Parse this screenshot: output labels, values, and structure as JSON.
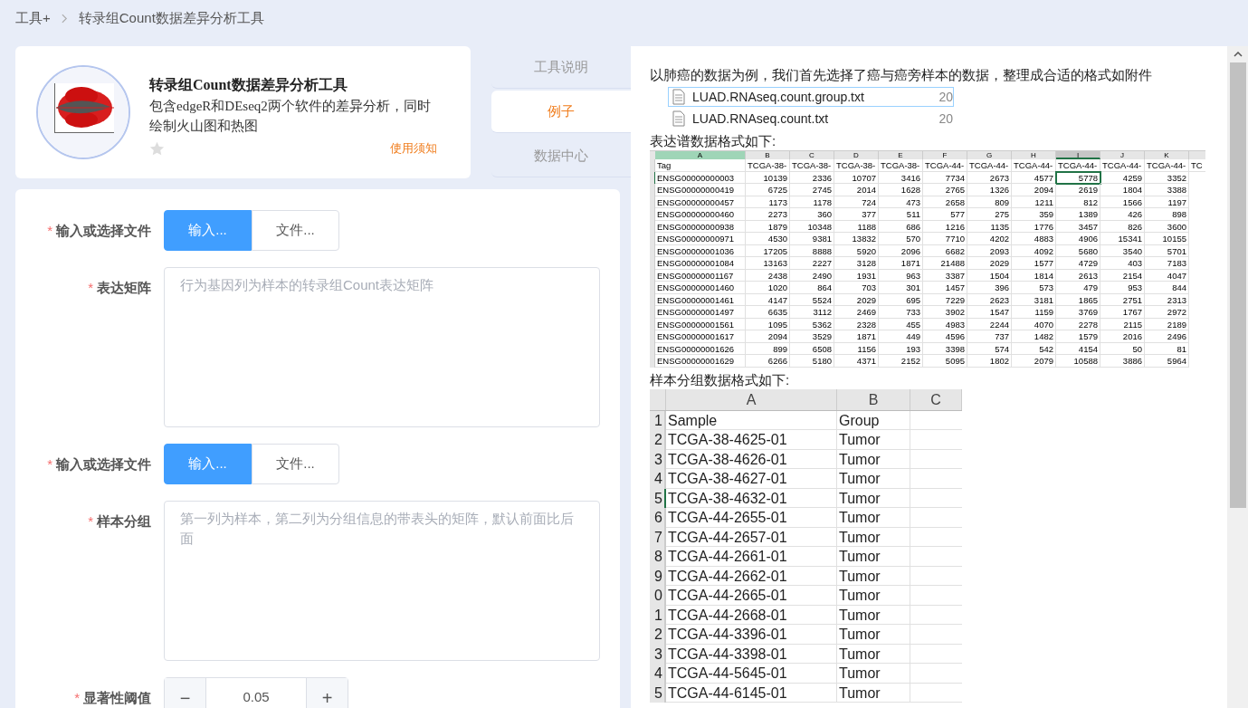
{
  "breadcrumb": [
    {
      "label": "工具+"
    },
    {
      "label": "转录组Count数据差异分析工具"
    }
  ],
  "tool_card": {
    "title": "转录组Count数据差异分析工具",
    "description": "包含edgeR和DEseq2两个软件的差异分析，同时绘制火山图和热图",
    "favorited": false,
    "link": "使用须知"
  },
  "tabs": [
    {
      "label": "工具说明",
      "selected": false
    },
    {
      "label": "例子",
      "selected": true
    },
    {
      "label": "数据中心",
      "selected": false
    }
  ],
  "form": [
    {
      "kind": "toggle",
      "label": "输入或选择文件",
      "required_mark": "*",
      "options": [
        {
          "label": "输入...",
          "selected": true
        },
        {
          "label": "文件...",
          "selected": false
        }
      ]
    },
    {
      "kind": "textarea",
      "label": "表达矩阵",
      "required_mark": "*",
      "placeholder": "行为基因列为样本的转录组Count表达矩阵"
    },
    {
      "kind": "toggle",
      "label": "输入或选择文件",
      "required_mark": "*",
      "options": [
        {
          "label": "输入...",
          "selected": true
        },
        {
          "label": "文件...",
          "selected": false
        }
      ]
    },
    {
      "kind": "textarea",
      "label": "样本分组",
      "required_mark": "*",
      "placeholder": "第一列为样本，第二列为分组信息的带表头的矩阵，默认前面比后面"
    },
    {
      "kind": "stepper",
      "label": "显著性阈值",
      "required_mark": "*",
      "minus": "−",
      "value": "0.05",
      "plus": "+"
    }
  ],
  "example": {
    "intro": "以肺癌的数据为例，我们首先选择了癌与癌旁样本的数据，整理成合适的格式如附件",
    "files": [
      {
        "name": "LUAD.RNAseq.count.group.txt",
        "date": "20",
        "selected": true
      },
      {
        "name": "LUAD.RNAseq.count.txt",
        "date": "20",
        "selected": false
      }
    ],
    "matrix_caption": "表达谱数据格式如下:",
    "matrix_sheet": {
      "columns": [
        {
          "label": "A",
          "selected": false,
          "highlight": true
        },
        {
          "label": "B",
          "selected": false,
          "highlight": false
        },
        {
          "label": "C",
          "selected": false,
          "highlight": false
        },
        {
          "label": "D",
          "selected": false,
          "highlight": false
        },
        {
          "label": "E",
          "selected": false,
          "highlight": false
        },
        {
          "label": "F",
          "selected": false,
          "highlight": false
        },
        {
          "label": "G",
          "selected": false,
          "highlight": false
        },
        {
          "label": "H",
          "selected": false,
          "highlight": false
        },
        {
          "label": "I",
          "selected": true,
          "highlight": false
        },
        {
          "label": "J",
          "selected": false,
          "highlight": false
        },
        {
          "label": "K",
          "selected": false,
          "highlight": false
        }
      ],
      "rows": [
        {
          "selected": false,
          "cells": [
            "Tag",
            "TCGA-38-",
            "TCGA-38-",
            "TCGA-38-",
            "TCGA-38-",
            "TCGA-44-",
            "TCGA-44-",
            "TCGA-44-",
            "TCGA-44-",
            "TCGA-44-",
            "TCGA-44-",
            "TC"
          ]
        },
        {
          "selected": true,
          "cells": [
            "ENSG00000000003",
            "10139",
            "2336",
            "10707",
            "3416",
            "7734",
            "2673",
            "4577",
            "5778",
            "4259",
            "3352"
          ]
        },
        {
          "selected": false,
          "cells": [
            "ENSG00000000419",
            "6725",
            "2745",
            "2014",
            "1628",
            "2765",
            "1326",
            "2094",
            "2619",
            "1804",
            "3388"
          ]
        },
        {
          "selected": false,
          "cells": [
            "ENSG00000000457",
            "1173",
            "1178",
            "724",
            "473",
            "2658",
            "809",
            "1211",
            "812",
            "1566",
            "1197"
          ]
        },
        {
          "selected": false,
          "cells": [
            "ENSG00000000460",
            "2273",
            "360",
            "377",
            "511",
            "577",
            "275",
            "359",
            "1389",
            "426",
            "898"
          ]
        },
        {
          "selected": false,
          "cells": [
            "ENSG00000000938",
            "1879",
            "10348",
            "1188",
            "686",
            "1216",
            "1135",
            "1776",
            "3457",
            "826",
            "3600"
          ]
        },
        {
          "selected": false,
          "cells": [
            "ENSG00000000971",
            "4530",
            "9381",
            "13832",
            "570",
            "7710",
            "4202",
            "4883",
            "4906",
            "15341",
            "10155"
          ]
        },
        {
          "selected": false,
          "cells": [
            "ENSG00000001036",
            "17205",
            "8888",
            "5920",
            "2096",
            "6682",
            "2093",
            "4092",
            "5680",
            "3540",
            "5701"
          ]
        },
        {
          "selected": false,
          "cells": [
            "ENSG00000001084",
            "13163",
            "2227",
            "3128",
            "1871",
            "21488",
            "2029",
            "1577",
            "4729",
            "403",
            "7183"
          ]
        },
        {
          "selected": false,
          "cells": [
            "ENSG00000001167",
            "2438",
            "2490",
            "1931",
            "963",
            "3387",
            "1504",
            "1814",
            "2613",
            "2154",
            "4047"
          ]
        },
        {
          "selected": false,
          "cells": [
            "ENSG00000001460",
            "1020",
            "864",
            "703",
            "301",
            "1457",
            "396",
            "573",
            "479",
            "953",
            "844"
          ]
        },
        {
          "selected": false,
          "cells": [
            "ENSG00000001461",
            "4147",
            "5524",
            "2029",
            "695",
            "7229",
            "2623",
            "3181",
            "1865",
            "2751",
            "2313"
          ]
        },
        {
          "selected": false,
          "cells": [
            "ENSG00000001497",
            "6635",
            "3112",
            "2469",
            "733",
            "3902",
            "1547",
            "1159",
            "3769",
            "1767",
            "2972"
          ]
        },
        {
          "selected": false,
          "cells": [
            "ENSG00000001561",
            "1095",
            "5362",
            "2328",
            "455",
            "4983",
            "2244",
            "4070",
            "2278",
            "2115",
            "2189"
          ]
        },
        {
          "selected": false,
          "cells": [
            "ENSG00000001617",
            "2094",
            "3529",
            "1871",
            "449",
            "4596",
            "737",
            "1482",
            "1579",
            "2016",
            "2496"
          ]
        },
        {
          "selected": false,
          "cells": [
            "ENSG00000001626",
            "899",
            "6508",
            "1156",
            "193",
            "3398",
            "574",
            "542",
            "4154",
            "50",
            "81"
          ]
        },
        {
          "selected": false,
          "cells": [
            "ENSG00000001629",
            "6266",
            "5180",
            "4371",
            "2152",
            "5095",
            "1802",
            "2079",
            "10588",
            "3886",
            "5964"
          ]
        }
      ]
    },
    "group_caption": "样本分组数据格式如下:",
    "group_sheet": {
      "columns": [
        "A",
        "B",
        "C"
      ],
      "rows": [
        {
          "number": "1",
          "selected": false,
          "cells": [
            "Sample",
            "Group"
          ]
        },
        {
          "number": "2",
          "selected": false,
          "cells": [
            "TCGA-38-4625-01",
            "Tumor"
          ]
        },
        {
          "number": "3",
          "selected": false,
          "cells": [
            "TCGA-38-4626-01",
            "Tumor"
          ]
        },
        {
          "number": "4",
          "selected": false,
          "cells": [
            "TCGA-38-4627-01",
            "Tumor"
          ]
        },
        {
          "number": "5",
          "selected": true,
          "cells": [
            "TCGA-38-4632-01",
            "Tumor"
          ]
        },
        {
          "number": "6",
          "selected": false,
          "cells": [
            "TCGA-44-2655-01",
            "Tumor"
          ]
        },
        {
          "number": "7",
          "selected": false,
          "cells": [
            "TCGA-44-2657-01",
            "Tumor"
          ]
        },
        {
          "number": "8",
          "selected": false,
          "cells": [
            "TCGA-44-2661-01",
            "Tumor"
          ]
        },
        {
          "number": "9",
          "selected": false,
          "cells": [
            "TCGA-44-2662-01",
            "Tumor"
          ]
        },
        {
          "number": "0",
          "selected": false,
          "cells": [
            "TCGA-44-2665-01",
            "Tumor"
          ]
        },
        {
          "number": "1",
          "selected": false,
          "cells": [
            "TCGA-44-2668-01",
            "Tumor"
          ]
        },
        {
          "number": "2",
          "selected": false,
          "cells": [
            "TCGA-44-3396-01",
            "Tumor"
          ]
        },
        {
          "number": "3",
          "selected": false,
          "cells": [
            "TCGA-44-3398-01",
            "Tumor"
          ]
        },
        {
          "number": "4",
          "selected": false,
          "cells": [
            "TCGA-44-5645-01",
            "Tumor"
          ]
        },
        {
          "number": "5",
          "selected": false,
          "cells": [
            "TCGA-44-6145-01",
            "Tumor"
          ]
        }
      ]
    }
  }
}
